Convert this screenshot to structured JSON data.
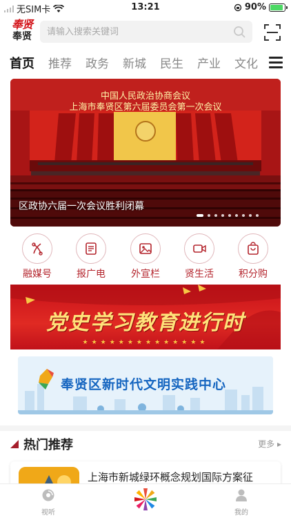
{
  "status_bar": {
    "carrier": "无SIM卡",
    "time": "13:21",
    "battery": "90%",
    "battery_level": 0.9
  },
  "header": {
    "logo_top": "奉贤",
    "logo_bottom": "奉贤",
    "search_placeholder": "请输入搜索关键词"
  },
  "tabs": [
    {
      "label": "首页",
      "active": true
    },
    {
      "label": "推荐"
    },
    {
      "label": "政务"
    },
    {
      "label": "新城"
    },
    {
      "label": "民生"
    },
    {
      "label": "产业"
    },
    {
      "label": "文化"
    }
  ],
  "banner": {
    "headline_line1": "中国人民政治协商会议",
    "headline_line2": "上海市奉贤区第六届委员会第一次会议",
    "caption": "区政协六届一次会议胜利闭幕",
    "slide_count": 9,
    "active_slide": 1
  },
  "quick_links": [
    {
      "label": "融媒号",
      "icon": "network-icon"
    },
    {
      "label": "报广电",
      "icon": "newspaper-icon"
    },
    {
      "label": "外宣栏",
      "icon": "image-icon"
    },
    {
      "label": "贤生活",
      "icon": "video-icon"
    },
    {
      "label": "积分购",
      "icon": "shopping-bag-icon"
    }
  ],
  "party_banner": {
    "title": "党史学习教育进行时"
  },
  "civ_banner": {
    "title": "奉贤区新时代文明实践中心"
  },
  "hot": {
    "title": "热门推荐",
    "more": "更多"
  },
  "news": [
    {
      "title": "上海市新城绿环概念规划国际方案征"
    }
  ],
  "bottom_nav": {
    "left_label": "视听",
    "right_label": "我的"
  },
  "colors": {
    "accent": "#b4252d",
    "brand_red": "#d3141a",
    "banner_red": "#c8111a"
  }
}
